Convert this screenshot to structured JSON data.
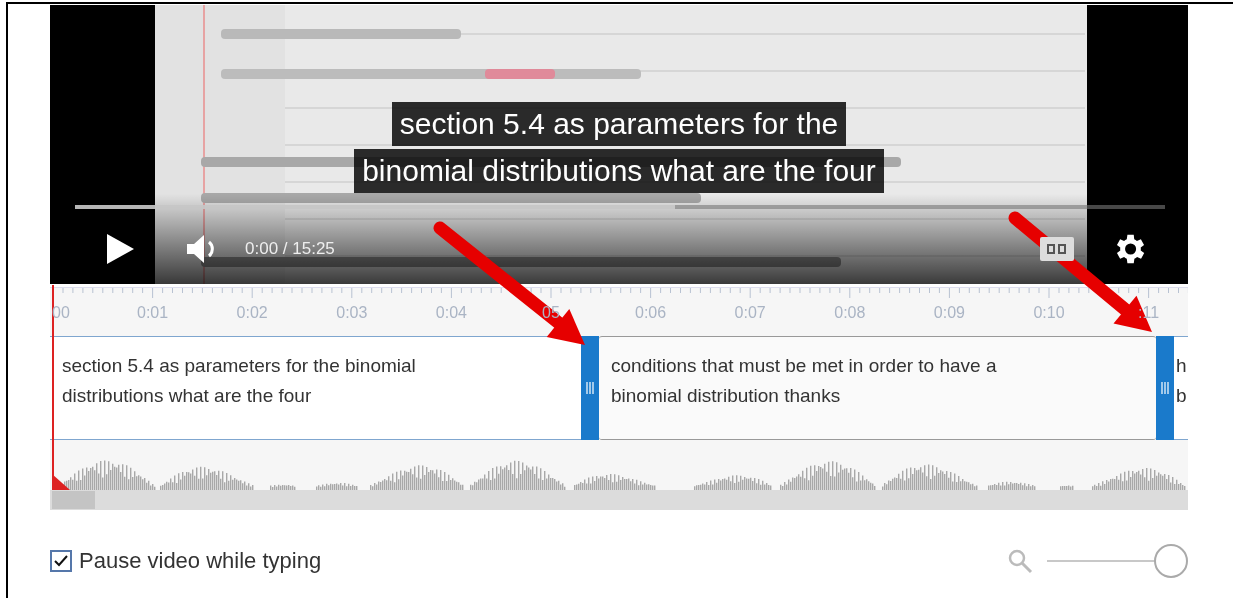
{
  "player": {
    "caption_lines": [
      "section 5.4 as parameters for the",
      "binomial distributions what are the four"
    ],
    "time": "0:00 / 15:25",
    "buffer": {
      "level": 0.55
    }
  },
  "timeline": {
    "labels": [
      "00",
      "0:01",
      "0:02",
      "0:03",
      "0:04",
      "05",
      "0:06",
      "0:07",
      "0:08",
      "0:09",
      "0:10",
      ":11"
    ],
    "captions": [
      {
        "lines": [
          "section 5.4 as parameters for the binomial",
          "distributions what are the four"
        ],
        "selected": false
      },
      {
        "lines": [
          "conditions that must be met in order to have a",
          "binomial distribution thanks"
        ],
        "selected": true
      },
      {
        "lines": [
          "h",
          "b"
        ],
        "selected": false
      }
    ]
  },
  "options": {
    "pause_while_typing": {
      "label": "Pause video while typing",
      "checked": true
    },
    "zoom": {
      "level": 1
    }
  }
}
